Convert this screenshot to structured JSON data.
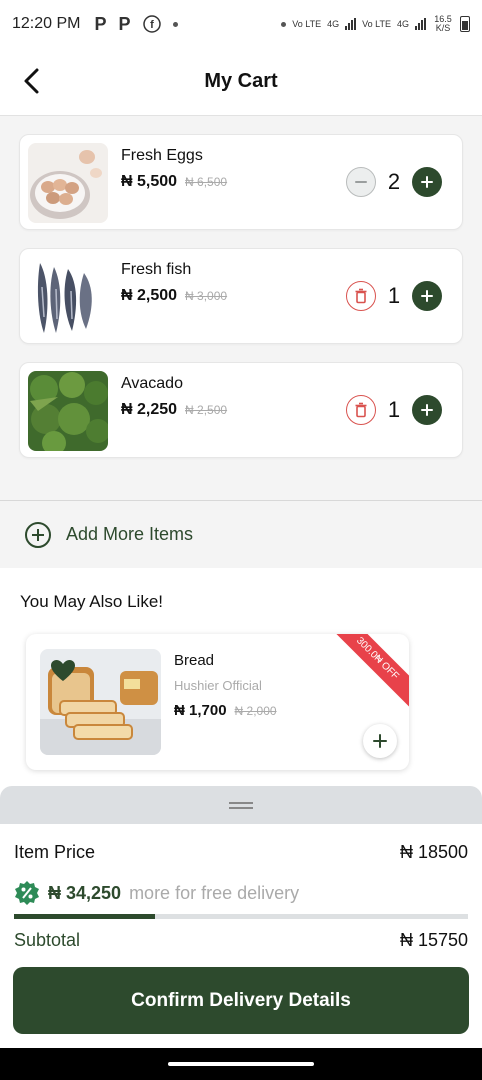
{
  "status_bar": {
    "time": "12:20 PM",
    "app_icon_1": "P",
    "app_icon_2": "P",
    "net_1": "Vo LTE",
    "net_2": "4G",
    "net_3": "Vo LTE",
    "net_4": "4G",
    "speed": "16.5 K/S"
  },
  "header": {
    "title": "My Cart"
  },
  "cart": {
    "items": [
      {
        "name": "Fresh Eggs",
        "price": "₦ 5,500",
        "old_price": "₦ 6,500",
        "qty": "2",
        "left_action": "minus"
      },
      {
        "name": "Fresh fish",
        "price": "₦ 2,500",
        "old_price": "₦ 3,000",
        "qty": "1",
        "left_action": "delete"
      },
      {
        "name": "Avacado",
        "price": "₦ 2,250",
        "old_price": "₦ 2,500",
        "qty": "1",
        "left_action": "delete"
      }
    ],
    "add_more_label": "Add More Items"
  },
  "suggestions": {
    "title": "You May Also Like!",
    "items": [
      {
        "name": "Bread",
        "seller": "Hushier Official",
        "price": "₦ 1,700",
        "old_price": "₦ 2,000",
        "badge": "300.0₦ OFF"
      }
    ]
  },
  "summary": {
    "item_price_label": "Item Price",
    "item_price_value": "₦ 18500",
    "delivery_amount": "₦ 34,250",
    "delivery_text": "more for free delivery",
    "delivery_progress": 0.31,
    "subtotal_label": "Subtotal",
    "subtotal_value": "₦ 15750",
    "confirm_label": "Confirm Delivery Details"
  },
  "colors": {
    "brand_green": "#2d4a2d",
    "delete_red": "#d9534f",
    "ribbon_red": "#e8424a"
  }
}
